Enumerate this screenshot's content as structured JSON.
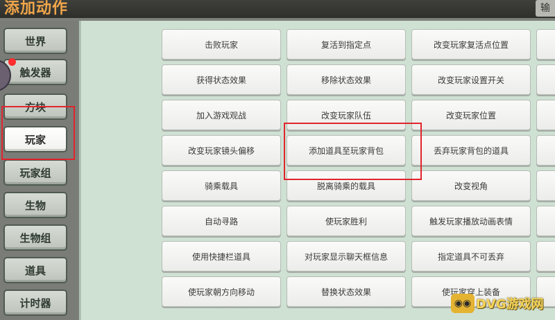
{
  "window": {
    "title": "添加动作",
    "right_label": "输"
  },
  "sidebar": {
    "items": [
      {
        "label": "世界"
      },
      {
        "label": "触发器"
      },
      {
        "label": "方块"
      },
      {
        "label": "玩家",
        "selected": true
      },
      {
        "label": "玩家组"
      },
      {
        "label": "生物"
      },
      {
        "label": "生物组"
      },
      {
        "label": "道具"
      },
      {
        "label": "计时器"
      }
    ]
  },
  "actions": [
    [
      "击败玩家",
      "复活到指定点",
      "改变玩家复活点位置"
    ],
    [
      "获得状态效果",
      "移除状态效果",
      "改变玩家设置开关"
    ],
    [
      "加入游戏观战",
      "改变玩家队伍",
      "改变玩家位置"
    ],
    [
      "改变玩家镜头偏移",
      "添加道具至玩家背包",
      "丢弃玩家背包的道具"
    ],
    [
      "骑乘载具",
      "脱离骑乘的载具",
      "改变视角"
    ],
    [
      "自动寻路",
      "使玩家胜利",
      "触发玩家播放动画表情"
    ],
    [
      "使用快捷栏道具",
      "对玩家显示聊天框信息",
      "指定道具不可丢弃"
    ],
    [
      "使玩家朝方向移动",
      "替换状态效果",
      "使玩家穿上装备"
    ]
  ],
  "watermark": {
    "text": "DVG游戏网",
    "icon": "gamepad-icon"
  },
  "colors": {
    "title": "#f0a64a",
    "highlight": "#e2242c",
    "content_bg": "#cfe1d3"
  }
}
